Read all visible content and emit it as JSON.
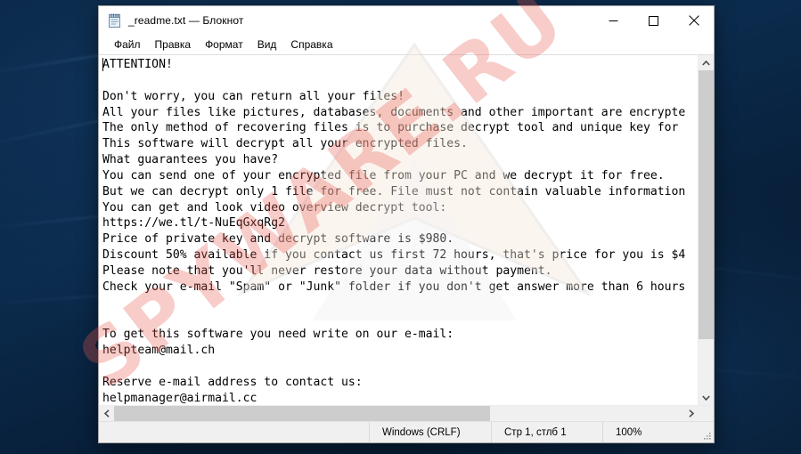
{
  "window": {
    "title": "_readme.txt — Блокнот",
    "icon": "notepad-icon",
    "minimize_label": "Свернуть",
    "maximize_label": "Развернуть",
    "close_label": "Закрыть"
  },
  "menu": {
    "items": [
      {
        "label": "Файл"
      },
      {
        "label": "Правка"
      },
      {
        "label": "Формат"
      },
      {
        "label": "Вид"
      },
      {
        "label": "Справка"
      }
    ]
  },
  "document": {
    "filename": "_readme.txt",
    "text": "ATTENTION!\n\nDon't worry, you can return all your files!\nAll your files like pictures, databases, documents and other important are encrypte\nThe only method of recovering files is to purchase decrypt tool and unique key for\nThis software will decrypt all your encrypted files.\nWhat guarantees you have?\nYou can send one of your encrypted file from your PC and we decrypt it for free.\nBut we can decrypt only 1 file for free. File must not contain valuable information\nYou can get and look video overview decrypt tool:\nhttps://we.tl/t-NuEqGxqRg2\nPrice of private key and decrypt software is $980.\nDiscount 50% available if you contact us first 72 hours, that's price for you is $4\nPlease note that you'll never restore your data without payment.\nCheck your e-mail \"Spam\" or \"Junk\" folder if you don't get answer more than 6 hours\n\n\nTo get this software you need write on our e-mail:\nhelpteam@mail.ch\n\nReserve e-mail address to contact us:\nhelpmanager@airmail.cc",
    "video_url": "https://we.tl/t-NuEqGxqRg2",
    "price": "$980",
    "discount": "50%",
    "discount_window": "72 hours",
    "primary_email": "helpteam@mail.ch",
    "reserve_email": "helpmanager@airmail.cc"
  },
  "statusbar": {
    "encoding": "Windows (CRLF)",
    "line_column": "Стр 1, стлб 1",
    "zoom": "100%"
  },
  "scrollbars": {
    "vertical_thumb_percent": 84,
    "horizontal_thumb_percent": 66,
    "up_arrow": "chevron-up-icon",
    "down_arrow": "chevron-down-icon",
    "left_arrow": "chevron-left-icon",
    "right_arrow": "chevron-right-icon"
  },
  "watermark": {
    "text": "SPYWARE.RU",
    "color": "#e8584e"
  },
  "colors": {
    "desktop": "#0b2b4d",
    "window_bg": "#ffffff",
    "chrome": "#f0f0f0",
    "scroll_thumb": "#cdcdcd",
    "close_hover": "#e81123"
  }
}
